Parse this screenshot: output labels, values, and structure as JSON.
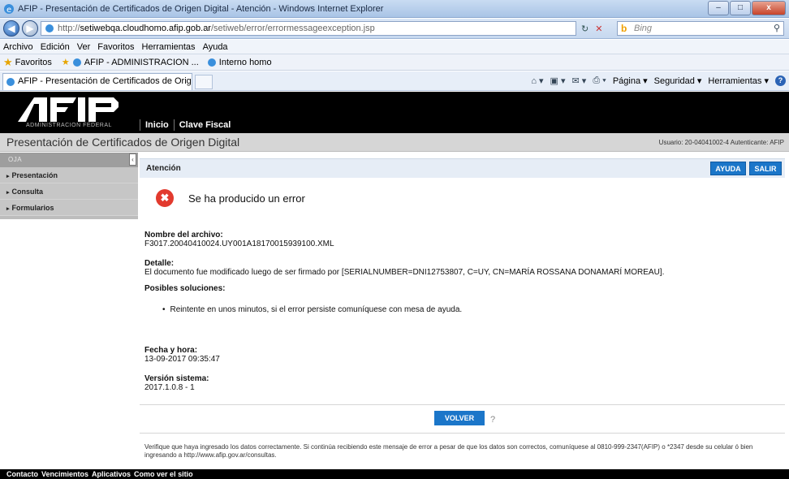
{
  "window": {
    "title": "AFIP - Presentación de Certificados de Origen Digital - Atención - Windows Internet Explorer",
    "buttons": [
      "–",
      "□",
      "x"
    ]
  },
  "address": {
    "url_prefix": "http://",
    "url_host": "setiwebqa.cloudhomo.afip.gob.ar",
    "url_path": "/setiweb/error/errormessageexception.jsp",
    "search_placeholder": "Bing"
  },
  "menu": [
    "Archivo",
    "Edición",
    "Ver",
    "Favoritos",
    "Herramientas",
    "Ayuda"
  ],
  "favorites": {
    "label": "Favoritos",
    "items": [
      "AFIP - ADMINISTRACION ...",
      "Interno homo"
    ]
  },
  "tab": {
    "label": "AFIP - Presentación de Certificados de Origen Di..."
  },
  "commandbar": {
    "pagina": "Página ▾",
    "seguridad": "Seguridad ▾",
    "herramientas": "Herramientas ▾"
  },
  "afip": {
    "logo_sub": "ADMINISTRACION FEDERAL",
    "nav": [
      "Inicio",
      "Clave Fiscal"
    ],
    "app_title": "Presentación de Certificados de Origen Digital",
    "user": "Usuario: 20-04041002-4 Autenticante: AFIP"
  },
  "sidebar": {
    "header": "OJA",
    "items": [
      "Presentación",
      "Consulta",
      "Formularios"
    ]
  },
  "content": {
    "attn_label": "Atención",
    "btn_ayuda": "AYUDA",
    "btn_salir": "SALIR",
    "error_title": "Se ha producido un error",
    "file_label": "Nombre del archivo:",
    "file_value": "F3017.20040410024.UY001A18170015939100.XML",
    "detail_label": "Detalle:",
    "detail_value": "El documento fue modificado luego de ser firmado por [SERIALNUMBER=DNI12753807, C=UY, CN=MARÍA ROSSANA DONAMARÍ MOREAU].",
    "solutions_label": "Posibles soluciones:",
    "solution_1": "Reintente en unos minutos, si el error persiste comuníquese con mesa de ayuda.",
    "datetime_label": "Fecha y hora:",
    "datetime_value": "13-09-2017 09:35:47",
    "version_label": "Versión sistema:",
    "version_value": "2017.1.0.8 - 1",
    "btn_volver": "VOLVER",
    "help_q": "?",
    "note_1": "Verifique que haya ingresado los datos correctamente. Si continúa recibiendo este mensaje de error a pesar de que los datos son correctos, comuníquese al 0810-999-2347(AFIP) o *2347 desde su celular ó bien",
    "note_2": "ingresando a http://www.afip.gov.ar/consultas."
  },
  "footer": [
    "Contacto",
    "Vencimientos",
    "Aplicativos",
    "Como ver el sitio"
  ]
}
